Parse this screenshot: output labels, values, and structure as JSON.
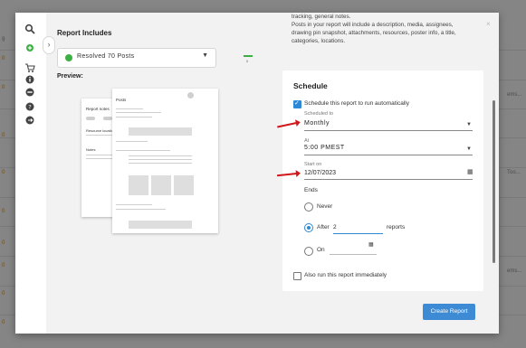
{
  "background": {
    "left_fragments": [
      "g",
      "0",
      "0",
      "0",
      "0",
      "0",
      "0",
      "0",
      "0",
      "0",
      "0"
    ],
    "right_fragments": [
      "ems...",
      "Too...",
      "ems..."
    ]
  },
  "rail": {
    "icons": [
      "search-icon",
      "plus-circle-icon",
      "cart-icon",
      "info-icon",
      "minus-circle-icon",
      "help-icon",
      "exit-icon"
    ]
  },
  "left": {
    "includes_title": "Report Includes",
    "select_value": "Resolved 70 Posts",
    "mini_value": "0",
    "preview_title": "Preview:",
    "preview_page1": {
      "title": "Report notes",
      "section": "Resource location",
      "notes": "Notes"
    },
    "preview_page2": {
      "title": "Posts"
    }
  },
  "right": {
    "description_lines": [
      "tracking, general notes.",
      "Posts in your report will include a description, media, assignees,",
      "drawing pin snapshot, attachments, resources, poster info, a title,",
      "categories, locations."
    ],
    "schedule_title": "Schedule",
    "auto_label": "Schedule this report to run automatically",
    "scheduled_to_label": "Scheduled to",
    "scheduled_to_value": "Monthly",
    "at_label": "At",
    "at_value": "5:00 PMEST",
    "start_label": "Start on",
    "start_value": "12/07/2023",
    "ends_label": "Ends",
    "never_label": "Never",
    "after_label": "After",
    "after_value": "2",
    "after_suffix": "reports",
    "on_label": "On",
    "run_now_label": "Also run this report immediately",
    "create_label": "Create Report",
    "close_label": "×"
  }
}
